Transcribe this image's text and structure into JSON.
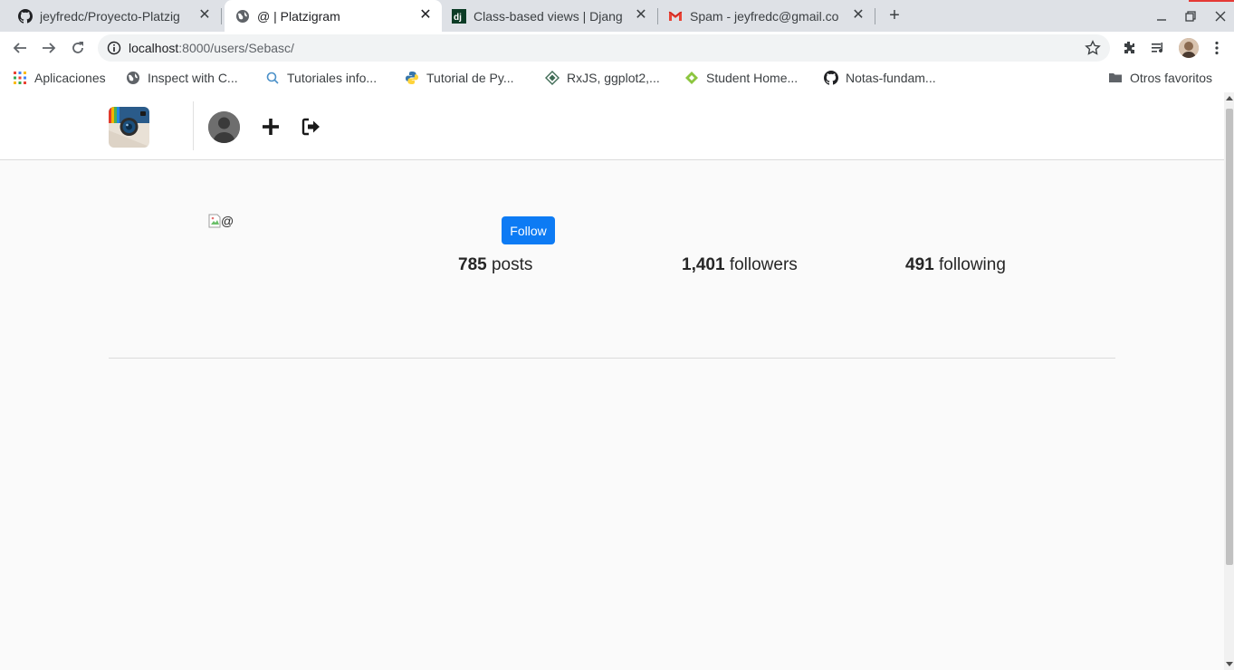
{
  "browser": {
    "tabs": [
      {
        "title": "jeyfredc/Proyecto-Platzig",
        "icon": "github-icon",
        "active": false
      },
      {
        "title": "@ | Platzigram",
        "icon": "globe-icon",
        "active": true
      },
      {
        "title": "Class-based views | Djang",
        "icon": "django-icon",
        "active": false
      },
      {
        "title": "Spam - jeyfredc@gmail.co",
        "icon": "gmail-icon",
        "active": false
      }
    ],
    "close_glyph": "✕",
    "new_tab_glyph": "+",
    "url_host": "localhost",
    "url_path": ":8000/users/Sebasc/"
  },
  "bookmarks": {
    "items": [
      {
        "label": "Aplicaciones",
        "icon": "apps-grid-icon"
      },
      {
        "label": "Inspect with C...",
        "icon": "globe-icon"
      },
      {
        "label": "Tutoriales info...",
        "icon": "tutorial-icon"
      },
      {
        "label": "Tutorial de Py...",
        "icon": "python-icon"
      },
      {
        "label": "RxJS, ggplot2,...",
        "icon": "diamond-icon"
      },
      {
        "label": "Student Home...",
        "icon": "student-icon"
      },
      {
        "label": "Notas-fundam...",
        "icon": "github-icon"
      }
    ],
    "other": "Otros favoritos"
  },
  "page": {
    "profile_image_alt": "@",
    "follow_label": "Follow",
    "stats": {
      "posts_count": "785",
      "posts_label": "posts",
      "followers_count": "1,401",
      "followers_label": "followers",
      "following_count": "491",
      "following_label": "following"
    }
  },
  "colors": {
    "accent": "#0d7bf4",
    "tabstrip": "#dee1e6"
  }
}
